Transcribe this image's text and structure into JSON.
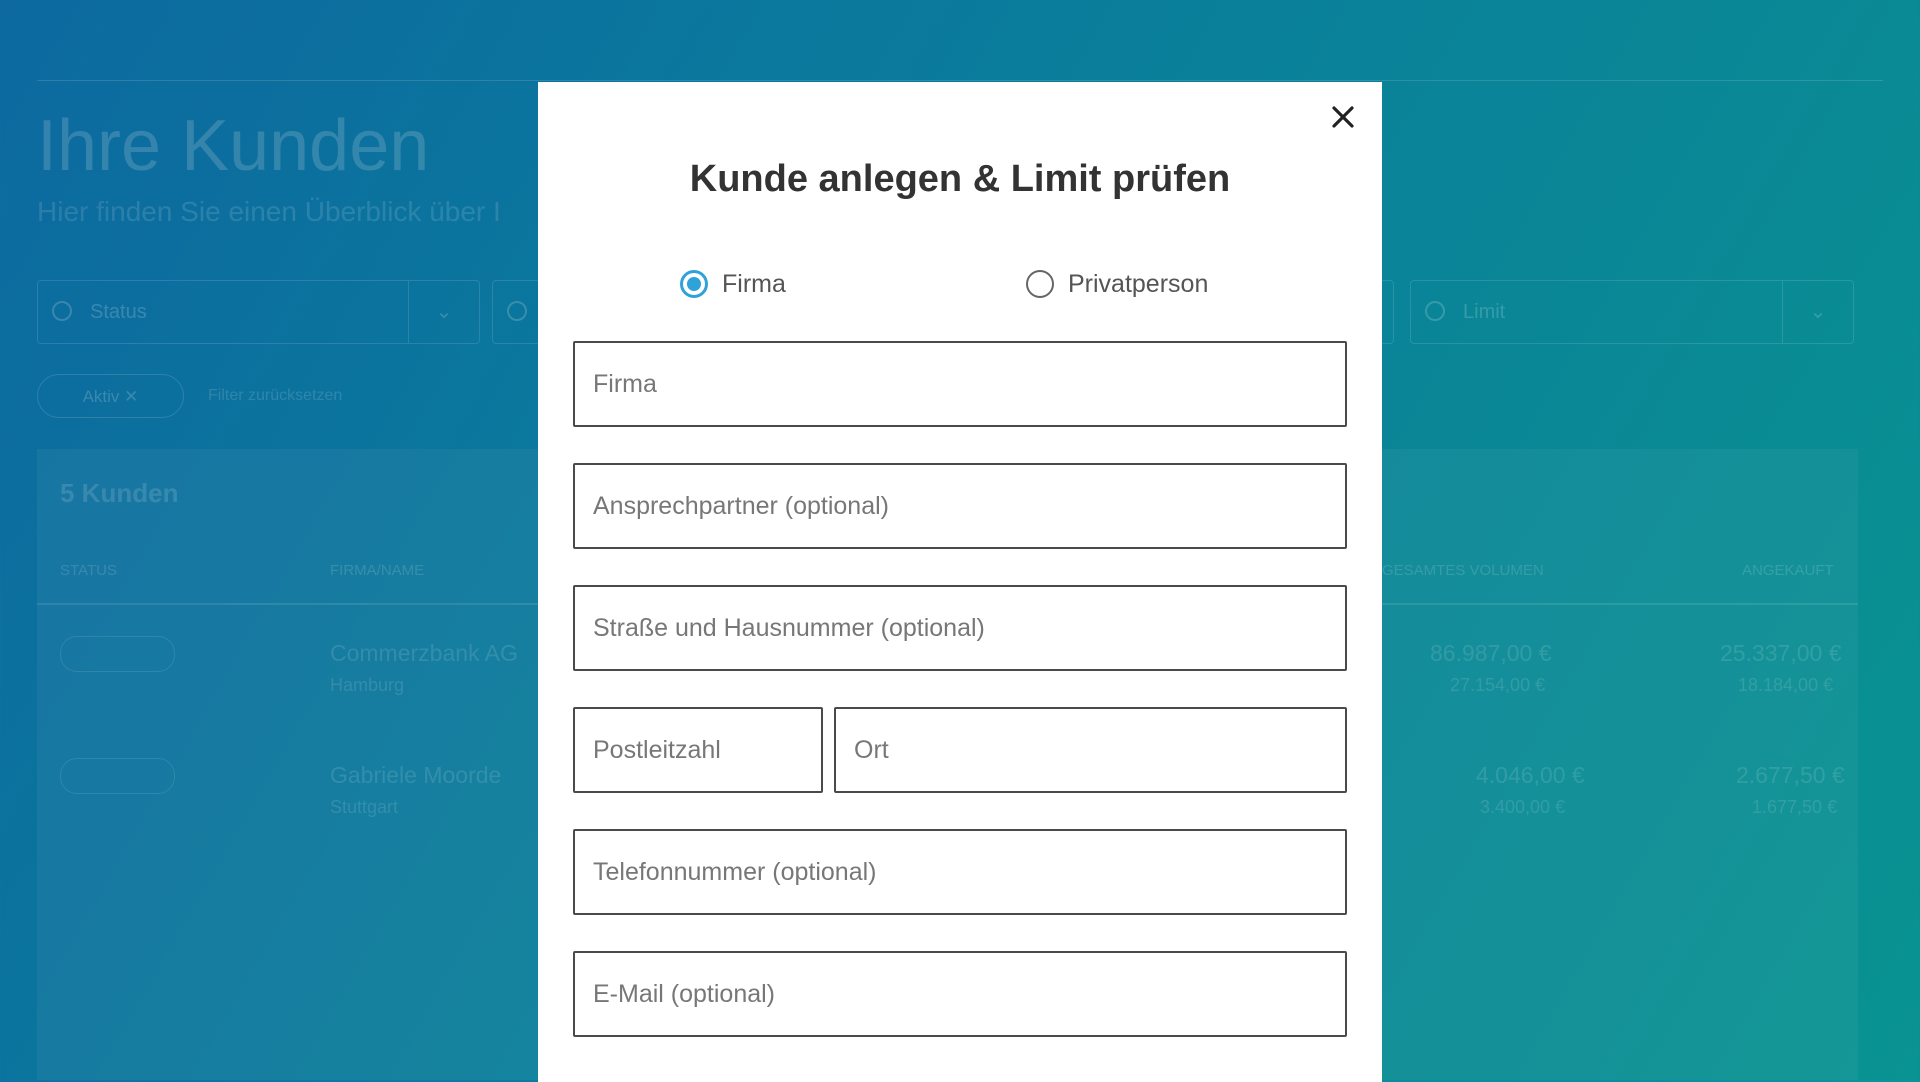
{
  "background": {
    "title": "Ihre Kunden",
    "subtitle": "Hier finden Sie einen Überblick über I",
    "filters": {
      "status": "Status",
      "limit": "Limit"
    },
    "chip": "Aktiv",
    "reset": "Filter zurücksetzen",
    "count": "5 Kunden",
    "columns": [
      "Status",
      "Firma/Name",
      "Gesamtes Volumen",
      "Angekauft"
    ],
    "rows": [
      {
        "name": "Commerzbank AG",
        "sub": "Hamburg",
        "volume": "86.987,00 €",
        "volume_sub": "27.154,00 €",
        "purchased": "25.337,00 €",
        "purchased_sub": "18.184,00 €"
      },
      {
        "name": "Gabriele Moorde",
        "sub": "Stuttgart",
        "volume": "4.046,00 €",
        "volume_sub": "3.400,00 €",
        "purchased": "2.677,50 €",
        "purchased_sub": "1.677,50 €"
      }
    ]
  },
  "modal": {
    "title": "Kunde anlegen & Limit prüfen",
    "close_icon": "close-icon",
    "customer_type": {
      "options": [
        {
          "label": "Firma",
          "checked": true
        },
        {
          "label": "Privatperson",
          "checked": false
        }
      ]
    },
    "fields": {
      "company": {
        "placeholder": "Firma",
        "value": ""
      },
      "contact": {
        "placeholder": "Ansprechpartner (optional)",
        "value": ""
      },
      "street": {
        "placeholder": "Straße und Hausnummer (optional)",
        "value": ""
      },
      "zip": {
        "placeholder": "Postleitzahl",
        "value": ""
      },
      "city": {
        "placeholder": "Ort",
        "value": ""
      },
      "phone": {
        "placeholder": "Telefonnummer (optional)",
        "value": ""
      },
      "email": {
        "placeholder": "E-Mail (optional)",
        "value": ""
      }
    },
    "accent_color": "#2fa3d9"
  }
}
